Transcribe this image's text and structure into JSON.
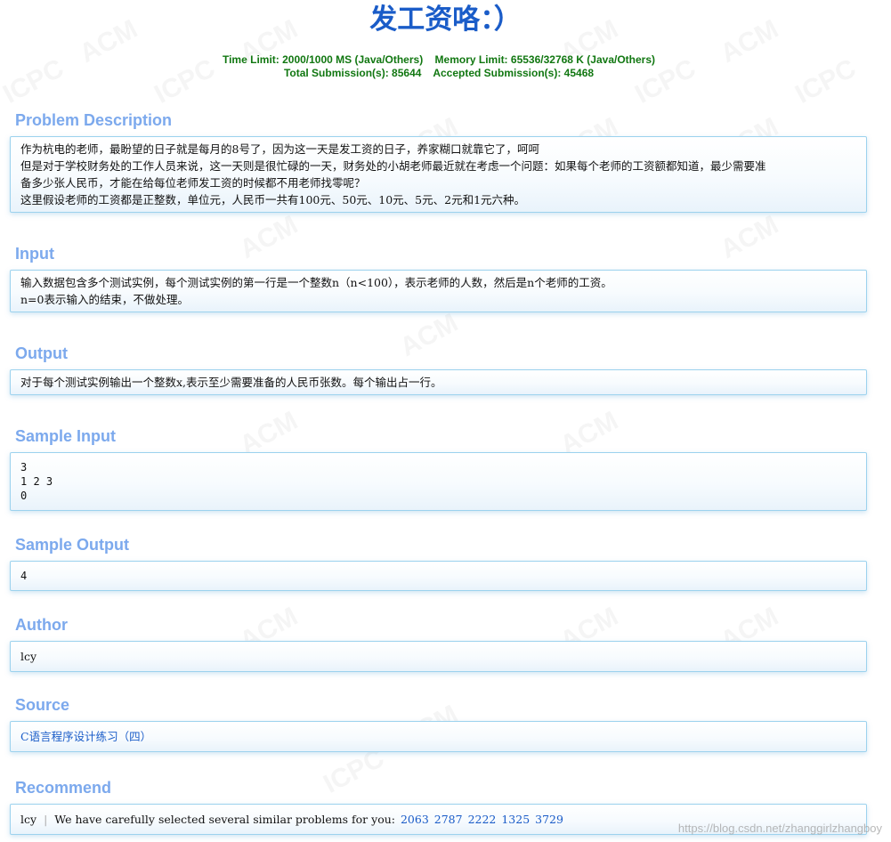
{
  "problem": {
    "title": "发工资咯：）",
    "time_limit": "Time Limit: 2000/1000 MS (Java/Others)",
    "memory_limit": "Memory Limit: 65536/32768 K (Java/Others)",
    "total_submissions": "Total Submission(s): 85644",
    "accepted_submissions": "Accepted Submission(s): 45468"
  },
  "sections": {
    "description": {
      "title": "Problem Description",
      "lines": [
        "作为杭电的老师，最盼望的日子就是每月的8号了，因为这一天是发工资的日子，养家糊口就靠它了，呵呵",
        "但是对于学校财务处的工作人员来说，这一天则是很忙碌的一天，财务处的小胡老师最近就在考虑一个问题：如果每个老师的工资额都知道，最少需要准",
        "备多少张人民币，才能在给每位老师发工资的时候都不用老师找零呢？",
        "这里假设老师的工资都是正整数，单位元，人民币一共有100元、50元、10元、5元、2元和1元六种。"
      ]
    },
    "input": {
      "title": "Input",
      "lines": [
        "输入数据包含多个测试实例，每个测试实例的第一行是一个整数n（n<100），表示老师的人数，然后是n个老师的工资。",
        "n=0表示输入的结束，不做处理。"
      ]
    },
    "output": {
      "title": "Output",
      "lines": [
        "对于每个测试实例输出一个整数x,表示至少需要准备的人民币张数。每个输出占一行。"
      ]
    },
    "sample_input": {
      "title": "Sample Input",
      "text": "3\n1 2 3\n0"
    },
    "sample_output": {
      "title": "Sample Output",
      "text": "4"
    },
    "author": {
      "title": "Author",
      "value": "lcy"
    },
    "source": {
      "title": "Source",
      "value": "C语言程序设计练习（四）"
    },
    "recommend": {
      "title": "Recommend",
      "author": "lcy",
      "separator": "|",
      "text": "We have carefully selected several similar problems for you:",
      "ids": [
        "2063",
        "2787",
        "2222",
        "1325",
        "3729"
      ]
    }
  },
  "watermarks": {
    "acm": "ACM",
    "icpc": "ICPC",
    "csdn": "https://blog.csdn.net/zhanggirlzhangboy"
  },
  "colors": {
    "title": "#1a5cc8",
    "limits": "#117711",
    "section_title": "#7ca9ed",
    "panel_border": "#9cd2ee",
    "link": "#1a5cc8"
  }
}
